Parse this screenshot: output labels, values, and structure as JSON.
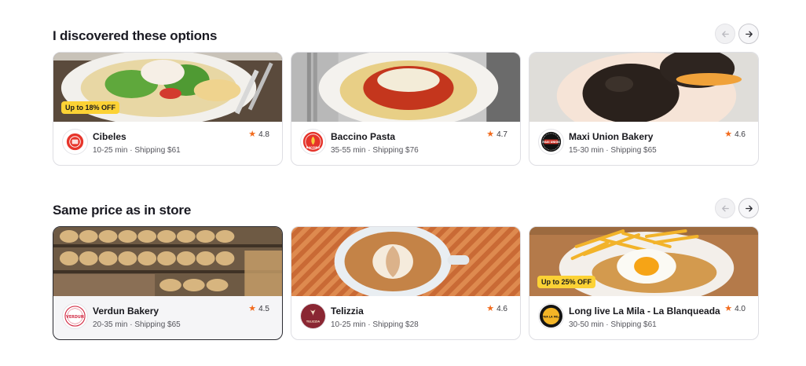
{
  "sections": [
    {
      "title": "I discovered these options",
      "cards": [
        {
          "name": "Cibeles",
          "meta": "10-25 min · Shipping $61",
          "rating": "4.8",
          "promo": "Up to 18% OFF"
        },
        {
          "name": "Baccino Pasta",
          "meta": "35-55 min · Shipping $76",
          "rating": "4.7",
          "promo": ""
        },
        {
          "name": "Maxi Union Bakery",
          "meta": "15-30 min · Shipping $65",
          "rating": "4.6",
          "promo": ""
        }
      ]
    },
    {
      "title": "Same price as in store",
      "cards": [
        {
          "name": "Verdun Bakery",
          "meta": "20-35 min · Shipping $65",
          "rating": "4.5",
          "promo": ""
        },
        {
          "name": "Telizzia",
          "meta": "10-25 min · Shipping $28",
          "rating": "4.6",
          "promo": ""
        },
        {
          "name": "Long live La Mila - La Blanqueada",
          "meta": "30-50 min · Shipping $61",
          "rating": "4.0",
          "promo": "Up to 25% OFF"
        }
      ]
    }
  ],
  "logos": {
    "baccino": "BACCINO",
    "maxi_union": "MAXI UNION",
    "verdun": "VERDUN",
    "telizzia": "TELIZZIA",
    "mila": "VIVA LA MILA"
  },
  "icons": {
    "star": "star-icon",
    "prev": "arrow-left-icon",
    "next": "arrow-right-icon"
  },
  "colors": {
    "star": "#f26b1d",
    "promo": "#fcd235"
  }
}
